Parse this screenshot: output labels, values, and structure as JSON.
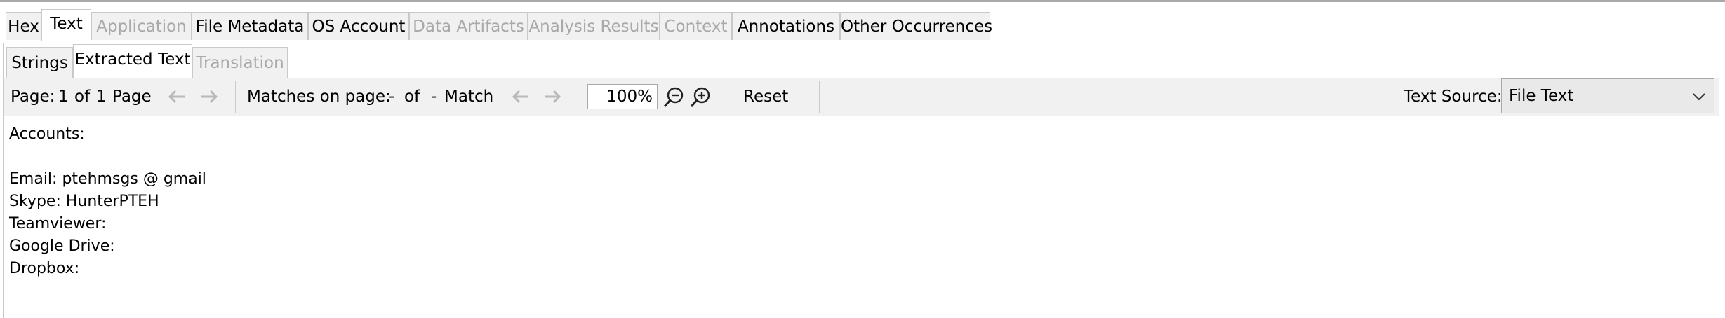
{
  "main_tabs": [
    {
      "label": "Hex",
      "state": "normal"
    },
    {
      "label": "Text",
      "state": "active"
    },
    {
      "label": "Application",
      "state": "disabled"
    },
    {
      "label": "File Metadata",
      "state": "normal"
    },
    {
      "label": "OS Account",
      "state": "normal"
    },
    {
      "label": "Data Artifacts",
      "state": "disabled"
    },
    {
      "label": "Analysis Results",
      "state": "disabled"
    },
    {
      "label": "Context",
      "state": "disabled"
    },
    {
      "label": "Annotations",
      "state": "normal"
    },
    {
      "label": "Other Occurrences",
      "state": "normal"
    }
  ],
  "sub_tabs": [
    {
      "label": "Strings",
      "state": "normal"
    },
    {
      "label": "Extracted Text",
      "state": "active"
    },
    {
      "label": "Translation",
      "state": "disabled"
    }
  ],
  "toolbar": {
    "page_label": "Page:",
    "page_current": "1",
    "page_of": "of",
    "page_total": "1",
    "page_unit": "Page",
    "matches_label": "Matches on page:",
    "match_current": "-",
    "match_of": "of",
    "match_total": "-",
    "match_unit": "Match",
    "zoom_value": "100%",
    "reset_label": "Reset",
    "text_source_label": "Text Source:",
    "text_source_value": "File Text"
  },
  "content": {
    "lines": [
      "Accounts:",
      "",
      "Email: ptehmsgs @ gmail",
      "Skype: HunterPTEH",
      "Teamviewer:",
      "Google Drive:",
      "Dropbox:"
    ]
  },
  "colors": {
    "tab_bg": "#f1f1f1",
    "disabled_text": "#a9a9a9",
    "border": "#c9c9c9"
  },
  "icons": {
    "prev": "arrow-left-icon",
    "next": "arrow-right-icon",
    "zoom_out": "zoom-out-icon",
    "zoom_in": "zoom-in-icon",
    "dropdown": "chevron-down-icon"
  }
}
